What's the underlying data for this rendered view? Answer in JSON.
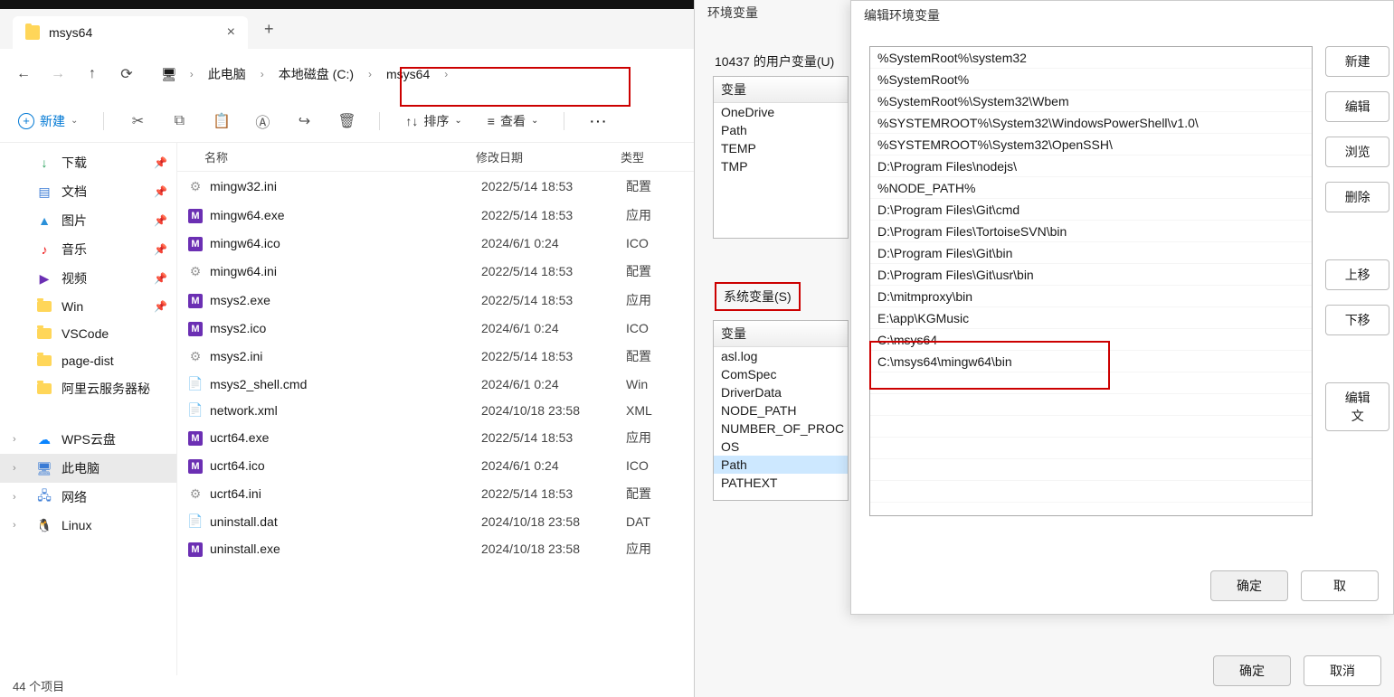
{
  "explorer": {
    "tab_title": "msys64",
    "breadcrumb": [
      "此电脑",
      "本地磁盘 (C:)",
      "msys64"
    ],
    "toolbar": {
      "new": "新建",
      "sort": "排序",
      "view": "查看"
    },
    "columns": {
      "name": "名称",
      "date": "修改日期",
      "type": "类型"
    },
    "sidebar": {
      "quick": [
        {
          "label": "下载",
          "color": "#1f9d55",
          "glyph": "↓",
          "pin": true
        },
        {
          "label": "文档",
          "color": "#3a7bd5",
          "glyph": "▤",
          "pin": true
        },
        {
          "label": "图片",
          "color": "#2b90d9",
          "glyph": "▲",
          "pin": true
        },
        {
          "label": "音乐",
          "color": "#e11",
          "glyph": "♪",
          "pin": true
        },
        {
          "label": "视频",
          "color": "#6b2fb3",
          "glyph": "▶",
          "pin": true
        },
        {
          "label": "Win",
          "folder": true,
          "pin": true
        },
        {
          "label": "VSCode",
          "folder": true
        },
        {
          "label": "page-dist",
          "folder": true
        },
        {
          "label": "阿里云服务器秘",
          "folder": true
        }
      ],
      "tree": [
        {
          "label": "WPS云盘",
          "color": "#0a84ff",
          "glyph": "☁",
          "chev": true
        },
        {
          "label": "此电脑",
          "color": "#3a7bd5",
          "glyph": "🖥",
          "chev": true,
          "selected": true
        },
        {
          "label": "网络",
          "color": "#3a7bd5",
          "glyph": "🖧",
          "chev": true
        },
        {
          "label": "Linux",
          "color": "#222",
          "glyph": "🐧",
          "chev": true
        }
      ]
    },
    "files": [
      {
        "icon": "ini",
        "name": "mingw32.ini",
        "date": "2022/5/14 18:53",
        "type": "配置"
      },
      {
        "icon": "m",
        "name": "mingw64.exe",
        "date": "2022/5/14 18:53",
        "type": "应用"
      },
      {
        "icon": "m",
        "name": "mingw64.ico",
        "date": "2024/6/1 0:24",
        "type": "ICO"
      },
      {
        "icon": "ini",
        "name": "mingw64.ini",
        "date": "2022/5/14 18:53",
        "type": "配置"
      },
      {
        "icon": "m",
        "name": "msys2.exe",
        "date": "2022/5/14 18:53",
        "type": "应用"
      },
      {
        "icon": "m",
        "name": "msys2.ico",
        "date": "2024/6/1 0:24",
        "type": "ICO"
      },
      {
        "icon": "ini",
        "name": "msys2.ini",
        "date": "2022/5/14 18:53",
        "type": "配置"
      },
      {
        "icon": "doc",
        "name": "msys2_shell.cmd",
        "date": "2024/6/1 0:24",
        "type": "Win"
      },
      {
        "icon": "doc",
        "name": "network.xml",
        "date": "2024/10/18 23:58",
        "type": "XML"
      },
      {
        "icon": "m",
        "name": "ucrt64.exe",
        "date": "2022/5/14 18:53",
        "type": "应用"
      },
      {
        "icon": "m",
        "name": "ucrt64.ico",
        "date": "2024/6/1 0:24",
        "type": "ICO"
      },
      {
        "icon": "ini",
        "name": "ucrt64.ini",
        "date": "2022/5/14 18:53",
        "type": "配置"
      },
      {
        "icon": "doc",
        "name": "uninstall.dat",
        "date": "2024/10/18 23:58",
        "type": "DAT"
      },
      {
        "icon": "m",
        "name": "uninstall.exe",
        "date": "2024/10/18 23:58",
        "type": "应用"
      }
    ],
    "status": "44 个项目"
  },
  "envdlg": {
    "title": "环境变量",
    "user_section": "10437 的用户变量(U)",
    "user_header": "变量",
    "user_vars": [
      "OneDrive",
      "Path",
      "TEMP",
      "TMP"
    ],
    "sys_section": "系统变量(S)",
    "sys_header": "变量",
    "sys_vars": [
      "asl.log",
      "ComSpec",
      "DriverData",
      "NODE_PATH",
      "NUMBER_OF_PROC",
      "OS",
      "Path",
      "PATHEXT"
    ],
    "sys_selected": "Path",
    "ok": "确定",
    "cancel": "取消"
  },
  "editdlg": {
    "title": "编辑环境变量",
    "paths": [
      "%SystemRoot%\\system32",
      "%SystemRoot%",
      "%SystemRoot%\\System32\\Wbem",
      "%SYSTEMROOT%\\System32\\WindowsPowerShell\\v1.0\\",
      "%SYSTEMROOT%\\System32\\OpenSSH\\",
      "D:\\Program Files\\nodejs\\",
      "%NODE_PATH%",
      "D:\\Program Files\\Git\\cmd",
      "D:\\Program Files\\TortoiseSVN\\bin",
      "D:\\Program Files\\Git\\bin",
      "D:\\Program Files\\Git\\usr\\bin",
      "D:\\mitmproxy\\bin",
      "E:\\app\\KGMusic",
      "C:\\msys64",
      "C:\\msys64\\mingw64\\bin"
    ],
    "buttons": {
      "new": "新建",
      "edit": "编辑",
      "browse": "浏览",
      "delete": "删除",
      "up": "上移",
      "down": "下移",
      "edittext": "编辑文"
    },
    "ok": "确定",
    "cancel": "取"
  }
}
